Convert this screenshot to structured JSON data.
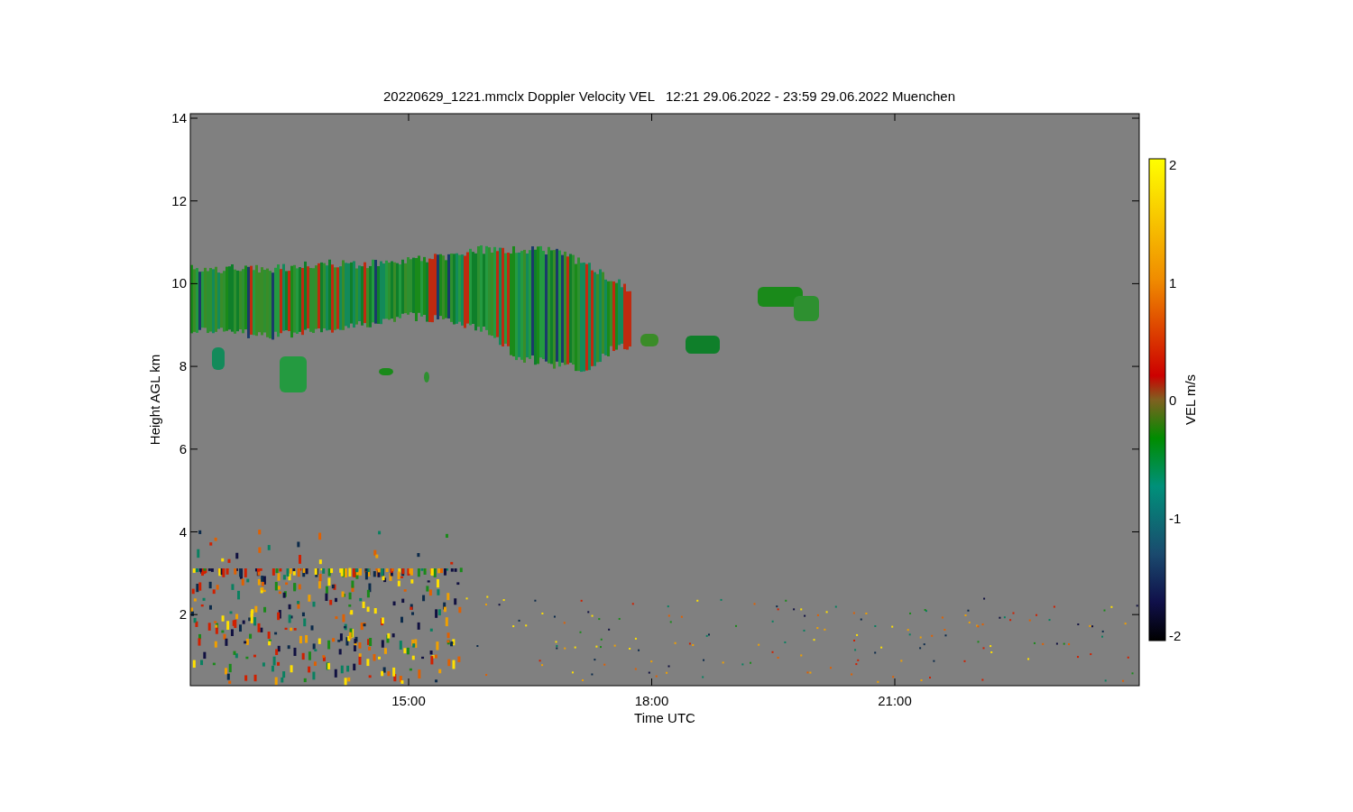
{
  "title": "20220629_1221.mmclx Doppler Velocity VEL   12:21 29.06.2022 - 23:59 29.06.2022 Muenchen",
  "plot": {
    "ylabel": "Height AGL km",
    "xlabel": "Time UTC",
    "yticks": [
      "14",
      "12",
      "10",
      "8",
      "6",
      "4",
      "2"
    ],
    "xticks": [
      "15:00",
      "18:00",
      "21:00"
    ]
  },
  "colorbar": {
    "label": "VEL m/s",
    "ticks": [
      "2",
      "1",
      "0",
      "-1",
      "-2"
    ]
  }
}
